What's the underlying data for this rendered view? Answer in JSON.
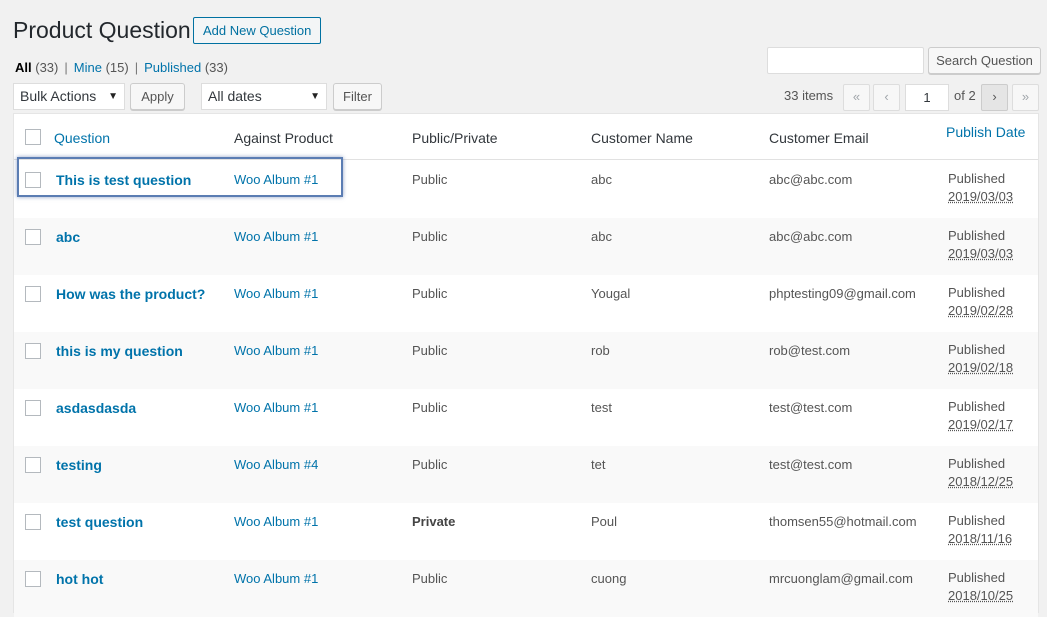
{
  "page": {
    "title": "Product Question",
    "add_new_label": "Add New Question"
  },
  "views": {
    "all_label": "All",
    "all_count": "(33)",
    "mine_label": "Mine",
    "mine_count": "(15)",
    "published_label": "Published",
    "published_count": "(33)",
    "separator": "|"
  },
  "search": {
    "button_label": "Search Question",
    "value": ""
  },
  "bulk": {
    "actions_selected": "Bulk Actions",
    "apply_label": "Apply",
    "dates_selected": "All dates",
    "filter_label": "Filter"
  },
  "pagination": {
    "items": "33 items",
    "first": "«",
    "prev": "‹",
    "current": "1",
    "of": "of 2",
    "next": "›",
    "last": "»"
  },
  "table": {
    "headers": {
      "question": "Question",
      "product": "Against Product",
      "visibility": "Public/Private",
      "customer_name": "Customer Name",
      "customer_email": "Customer Email",
      "publish_date": "Publish Date"
    },
    "rows": [
      {
        "question": "This is test question",
        "product": "Woo Album #1",
        "visibility": "Public",
        "name": "abc",
        "email": "abc@abc.com",
        "status": "Published",
        "date": "2019/03/03"
      },
      {
        "question": "abc",
        "product": "Woo Album #1",
        "visibility": "Public",
        "name": "abc",
        "email": "abc@abc.com",
        "status": "Published",
        "date": "2019/03/03"
      },
      {
        "question": "How was the product?",
        "product": "Woo Album #1",
        "visibility": "Public",
        "name": "Yougal",
        "email": "phptesting09@gmail.com",
        "status": "Published",
        "date": "2019/02/28"
      },
      {
        "question": "this is my question",
        "product": "Woo Album #1",
        "visibility": "Public",
        "name": "rob",
        "email": "rob@test.com",
        "status": "Published",
        "date": "2019/02/18"
      },
      {
        "question": "asdasdasda",
        "product": "Woo Album #1",
        "visibility": "Public",
        "name": "test",
        "email": "test@test.com",
        "status": "Published",
        "date": "2019/02/17"
      },
      {
        "question": "testing",
        "product": "Woo Album #4",
        "visibility": "Public",
        "name": "tet",
        "email": "test@test.com",
        "status": "Published",
        "date": "2018/12/25"
      },
      {
        "question": "test question",
        "product": "Woo Album #1",
        "visibility": "Private",
        "name": "Poul",
        "email": "thomsen55@hotmail.com",
        "status": "Published",
        "date": "2018/11/16"
      },
      {
        "question": "hot hot",
        "product": "Woo Album #1",
        "visibility": "Public",
        "name": "cuong",
        "email": "mrcuonglam@gmail.com",
        "status": "Published",
        "date": "2018/10/25"
      }
    ]
  }
}
